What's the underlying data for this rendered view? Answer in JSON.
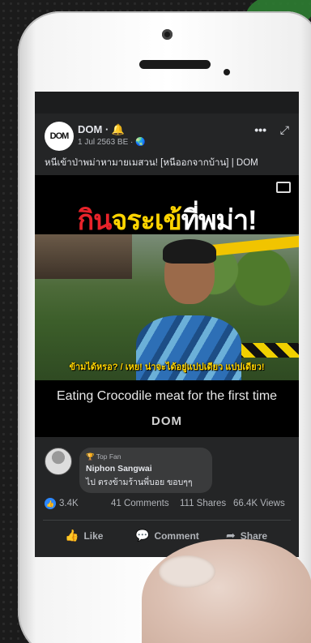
{
  "post": {
    "page_name": "DOM",
    "name_suffix": " · 🔔",
    "avatar_text": "DOM",
    "date": "1 Jul 2563 BE · 🌏",
    "more": "•••",
    "expand": "⤢",
    "text": "หนีเข้าป่าพม่าหามายเมสวน! [หนีออกจากบ้าน] | DOM"
  },
  "video": {
    "title_part1": "กิน",
    "title_part2": "จระเข้",
    "title_part3": "ที่พม่า!",
    "subtitle": "ข้ามได้หรอ? / เหย! น่าจะได้อยู่แปปเดียว แปปเดียว!",
    "caption": "Eating Crocodile meat for the first time",
    "logo": "DOM"
  },
  "comment": {
    "badge": "🏆 Top Fan",
    "name": "Niphon Sangwai",
    "text": "ไป ตรงข้ามร้านพี่บอย ขอบๆๆ"
  },
  "stats": {
    "likes": "3.4K",
    "comments": "41 Comments",
    "shares": "111 Shares",
    "views": "66.4K Views"
  },
  "actions": {
    "like": "Like",
    "comment": "Comment",
    "share": "Share"
  },
  "colors": {
    "screen_bg": "#242526",
    "accent_blue": "#2d88ff",
    "title_red": "#e8232a",
    "title_yellow": "#ffd400"
  }
}
